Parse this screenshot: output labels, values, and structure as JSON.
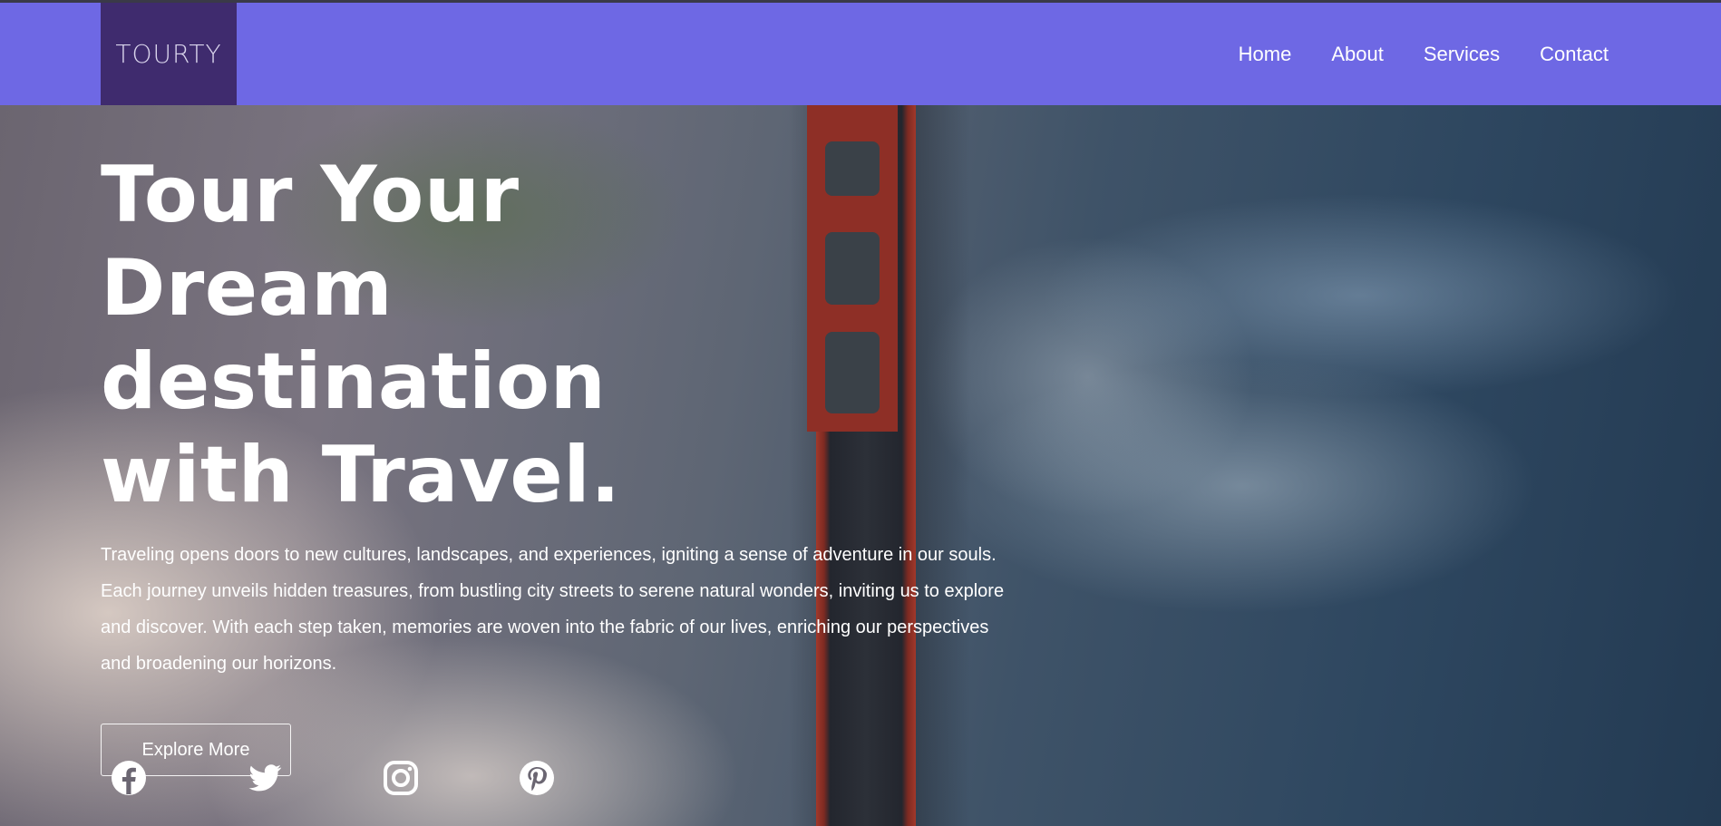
{
  "header": {
    "logo_text": "TOURTY",
    "nav": [
      {
        "label": "Home"
      },
      {
        "label": "About"
      },
      {
        "label": "Services"
      },
      {
        "label": "Contact"
      }
    ]
  },
  "hero": {
    "title": "Tour Your Dream destination with Travel.",
    "description": "Traveling opens doors to new cultures, landscapes, and experiences, igniting a sense of adventure in our souls. Each journey unveils hidden treasures, from bustling city streets to serene natural wonders, inviting us to explore and discover. With each step taken, memories are woven into the fabric of our lives, enriching our perspectives and broadening our horizons.",
    "cta_label": "Explore More"
  },
  "social": {
    "icons": [
      "facebook-icon",
      "twitter-icon",
      "instagram-icon",
      "pinterest-icon"
    ]
  },
  "colors": {
    "header_bg": "#6e68e4",
    "logo_bg": "#3f2b6e",
    "text": "#ffffff"
  }
}
